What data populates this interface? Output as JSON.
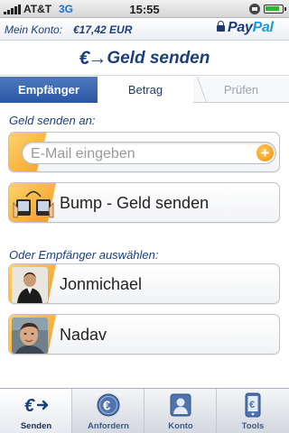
{
  "status_bar": {
    "carrier": "AT&T",
    "network": "3G",
    "time": "15:55"
  },
  "account_bar": {
    "label": "Mein Konto:",
    "balance": "€17,42 EUR",
    "brand_pay": "Pay",
    "brand_pal": "Pal"
  },
  "header": {
    "title_icon": "€→",
    "title": "Geld senden"
  },
  "steps": [
    {
      "label": "Empfänger",
      "state": "active"
    },
    {
      "label": "Betrag",
      "state": "next"
    },
    {
      "label": "Prüfen",
      "state": "disabled"
    }
  ],
  "send_to": {
    "label": "Geld senden an:",
    "email_placeholder": "E-Mail eingeben",
    "email_value": "",
    "add_icon": "+",
    "bump_label": "Bump - Geld senden"
  },
  "recipients": {
    "label": "Oder Empfänger auswählen:",
    "contacts": [
      {
        "name": "Jonmichael"
      },
      {
        "name": "Nadav"
      }
    ]
  },
  "tab_bar": {
    "tabs": [
      {
        "label": "Senden",
        "icon": "euro-send-icon",
        "active": true
      },
      {
        "label": "Anfordern",
        "icon": "euro-coin-icon",
        "active": false
      },
      {
        "label": "Konto",
        "icon": "person-icon",
        "active": false
      },
      {
        "label": "Tools",
        "icon": "phone-icon",
        "active": false
      }
    ]
  },
  "colors": {
    "brand_navy": "#1b3f7a",
    "accent_orange": "#f39b1e",
    "active_step_blue": "#2a57a3"
  }
}
